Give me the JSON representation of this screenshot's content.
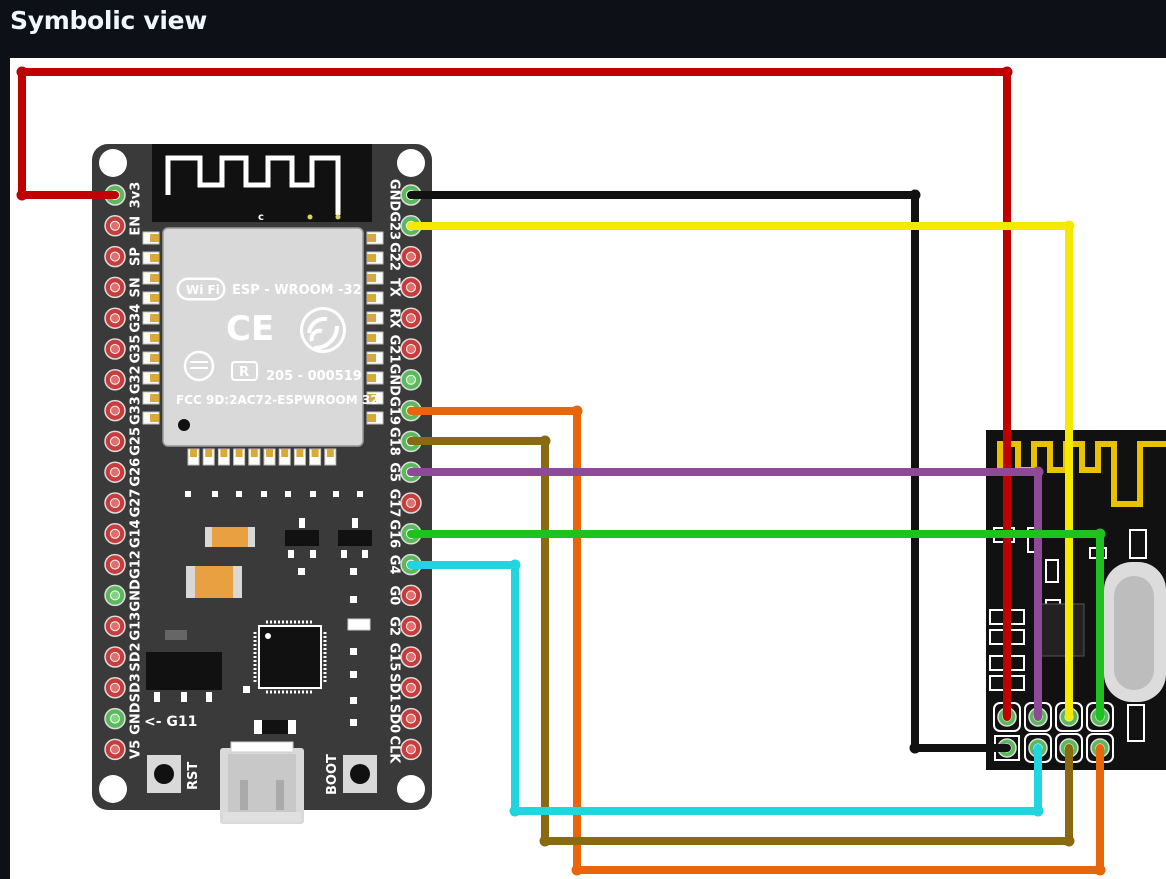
{
  "header": {
    "title": "Symbolic view"
  },
  "board": {
    "module_name": "ESP - WROOM -32",
    "wifi_label": "Wi Fi",
    "ce_mark": "CE",
    "reg_mark": "R",
    "cert_number": "205 - 000519",
    "fcc_id": "FCC 9D:2AC72-ESPWROOM 32",
    "antenna_mark": "c",
    "g11_label": "<- G11",
    "rst_label": "RST",
    "boot_label": "BOOT",
    "left_pins": [
      "3v3",
      "EN",
      "SP",
      "SN",
      "G34",
      "G35",
      "G32",
      "G33",
      "G25",
      "G26",
      "G27",
      "G14",
      "G12",
      "GND",
      "G13",
      "SD2",
      "SD3",
      "GND",
      "V5"
    ],
    "right_pins": [
      "GND",
      "G23",
      "G22",
      "TX",
      "RX",
      "G21",
      "GND",
      "G19",
      "G18",
      "G5",
      "G17",
      "G16",
      "G4",
      "G0",
      "G2",
      "G15",
      "SD1",
      "SD0",
      "CLK"
    ]
  },
  "wires": [
    {
      "name": "power-3v3-wire",
      "color": "#c00000"
    },
    {
      "name": "ground-wire",
      "color": "#111111"
    },
    {
      "name": "g23-wire",
      "color": "#f5e900"
    },
    {
      "name": "g19-wire",
      "color": "#e8650a"
    },
    {
      "name": "g18-wire",
      "color": "#8a6a10"
    },
    {
      "name": "g5-wire",
      "color": "#8e4a96"
    },
    {
      "name": "g16-wire",
      "color": "#1ec21e"
    },
    {
      "name": "g4-wire",
      "color": "#20d4e0"
    }
  ]
}
